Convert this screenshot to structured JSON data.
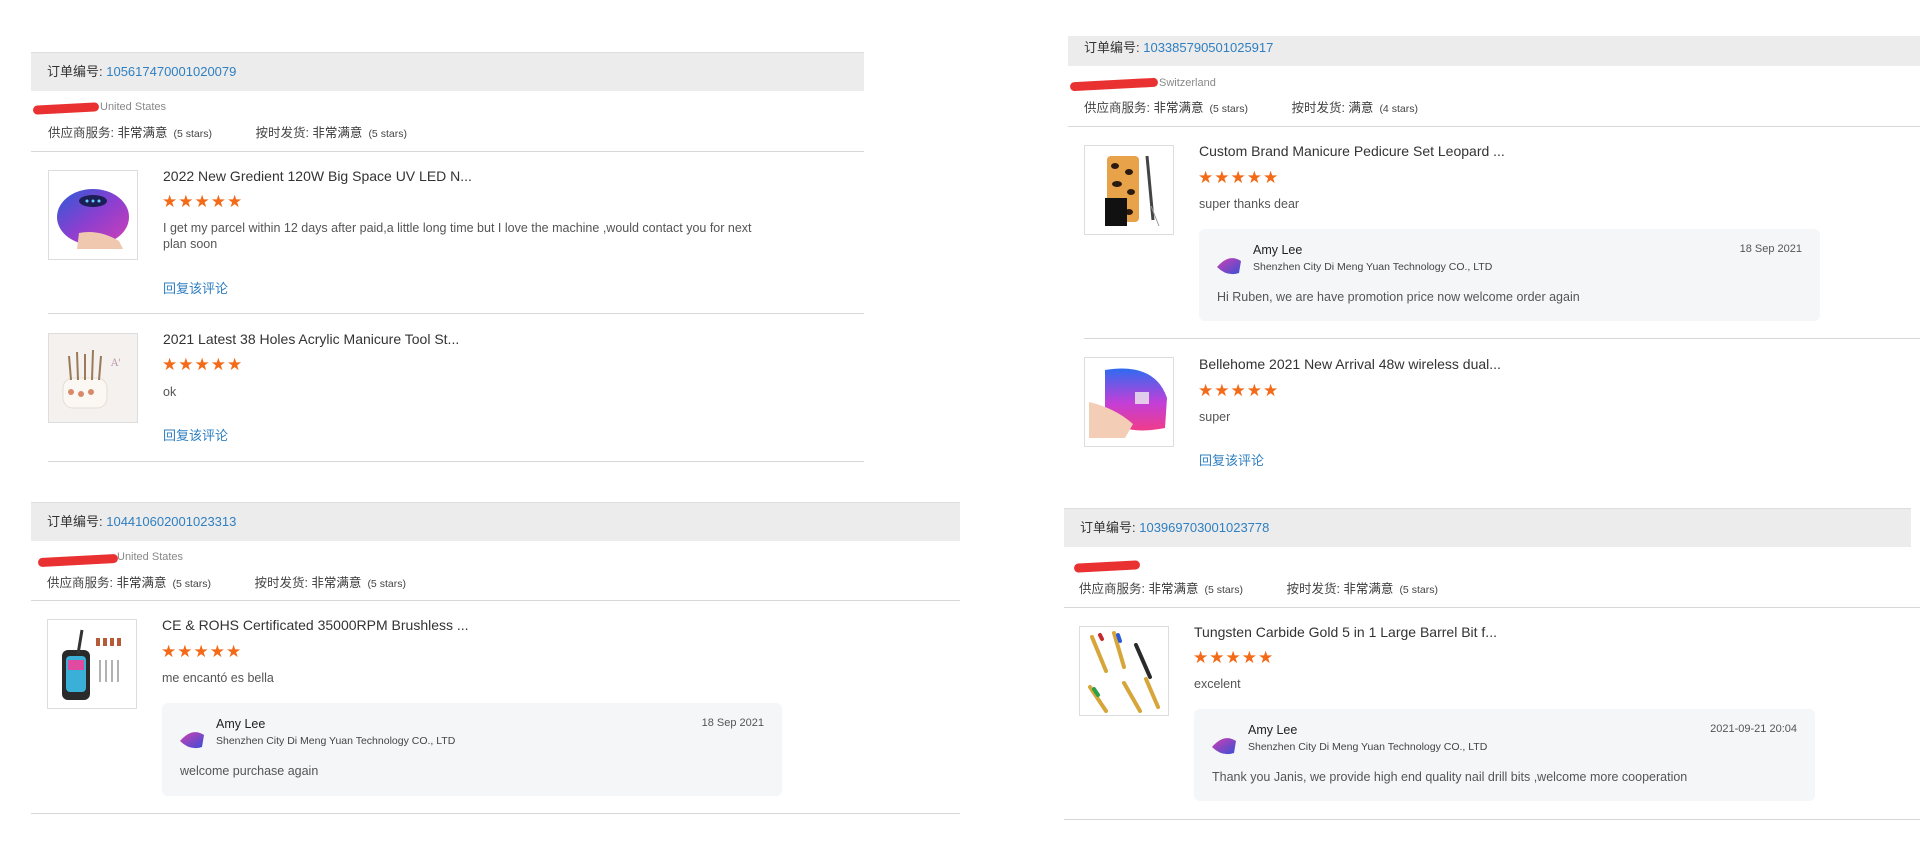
{
  "labels": {
    "order_prefix": "订单编号: ",
    "supplier_service": "供应商服务: ",
    "on_time_shipping": "按时发货: ",
    "reply_link": "回复该评论"
  },
  "colors": {
    "accent": "#2f7fc1",
    "star": "#f36a19",
    "header_bg": "#ececec",
    "reply_bg": "#f5f6f8"
  },
  "orders": [
    {
      "order_number": "105617470001020079",
      "country": "United States",
      "supplier_service": "非常满意",
      "supplier_stars": "(5 stars)",
      "on_time": "非常满意",
      "on_time_stars": "(5 stars)",
      "items": [
        {
          "title": "2022 New Gredient 120W Big Space UV LED N...",
          "stars": "★★★★★",
          "comment": "I get my parcel within 12 days after paid,a little long time but I love the machine ,would contact you for next plan soon",
          "image": "uv-lamp-purple"
        },
        {
          "title": "2021 Latest 38 Holes Acrylic Manicure Tool St...",
          "stars": "★★★★★",
          "comment": "ok",
          "image": "tool-stand"
        }
      ]
    },
    {
      "order_number": "104410602001023313",
      "country": "United States",
      "supplier_service": "非常满意",
      "supplier_stars": "(5 stars)",
      "on_time": "非常满意",
      "on_time_stars": "(5 stars)",
      "items": [
        {
          "title": "CE & ROHS Certificated 35000RPM Brushless ...",
          "stars": "★★★★★",
          "comment": "me encantó es bella",
          "image": "nail-drill",
          "reply": {
            "name": "Amy Lee",
            "company": "Shenzhen City Di Meng Yuan Technology CO., LTD",
            "date": "18 Sep 2021",
            "text": "welcome purchase again"
          }
        }
      ]
    },
    {
      "order_number": "103385790501025917",
      "country": "Switzerland",
      "supplier_service": "非常满意",
      "supplier_stars": "(5 stars)",
      "on_time": "满意",
      "on_time_stars": "(4 stars)",
      "items": [
        {
          "title": "Custom Brand Manicure Pedicure Set Leopard ...",
          "stars": "★★★★★",
          "comment": "super  thanks dear",
          "image": "leopard-set",
          "reply": {
            "name": "Amy Lee",
            "company": "Shenzhen City Di Meng Yuan Technology CO., LTD",
            "date": "18 Sep 2021",
            "text": "Hi Ruben, we are have promotion price now welcome order again"
          }
        },
        {
          "title": "Bellehome 2021 New Arrival 48w wireless dual...",
          "stars": "★★★★★",
          "comment": "super",
          "image": "uv-lamp-gradient"
        }
      ]
    },
    {
      "order_number": "103969703001023778",
      "country": "",
      "supplier_service": "非常满意",
      "supplier_stars": "(5 stars)",
      "on_time": "非常满意",
      "on_time_stars": "(5 stars)",
      "items": [
        {
          "title": "Tungsten Carbide Gold 5 in 1 Large Barrel Bit f...",
          "stars": "★★★★★",
          "comment": "excelent",
          "image": "drill-bits",
          "reply": {
            "name": "Amy Lee",
            "company": "Shenzhen City Di Meng Yuan Technology CO., LTD",
            "date": "2021-09-21 20:04",
            "text": "Thank you Janis, we provide high end quality nail drill bits ,welcome more cooperation"
          }
        }
      ]
    }
  ]
}
